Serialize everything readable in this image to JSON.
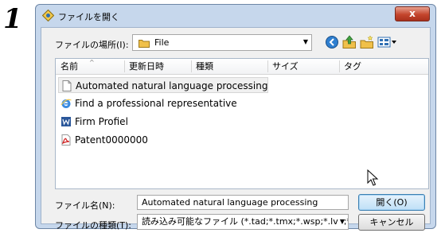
{
  "step_number": "1",
  "window": {
    "title": "ファイルを開く",
    "close_label": "x"
  },
  "location": {
    "label": "ファイルの場所(I):",
    "value": "File"
  },
  "toolbar": {
    "icons": [
      "back-icon",
      "up-folder-icon",
      "new-folder-icon",
      "view-menu-icon"
    ]
  },
  "columns": [
    "名前",
    "更新日時",
    "種類",
    "サイズ",
    "タグ"
  ],
  "files": [
    {
      "name": "Automated natural language processing",
      "icon": "document-icon",
      "selected": true
    },
    {
      "name": "Find a professional representative",
      "icon": "ie-link-icon",
      "selected": false
    },
    {
      "name": "Firm Profiel",
      "icon": "word-doc-icon",
      "selected": false
    },
    {
      "name": "Patent0000000",
      "icon": "pdf-icon",
      "selected": false
    }
  ],
  "file_name": {
    "label": "ファイル名(N):",
    "value": "Automated natural language processing"
  },
  "file_type": {
    "label": "ファイルの種類(T):",
    "value": "読み込み可能なファイル (*.tad;*.tmx;*.wsp;*.lvp;*.l"
  },
  "buttons": {
    "open": "開く(O)",
    "cancel": "キャンセル"
  },
  "colors": {
    "frame": "#c6d7ec",
    "close": "#c4452c",
    "open_button": "#bfe0f7"
  }
}
